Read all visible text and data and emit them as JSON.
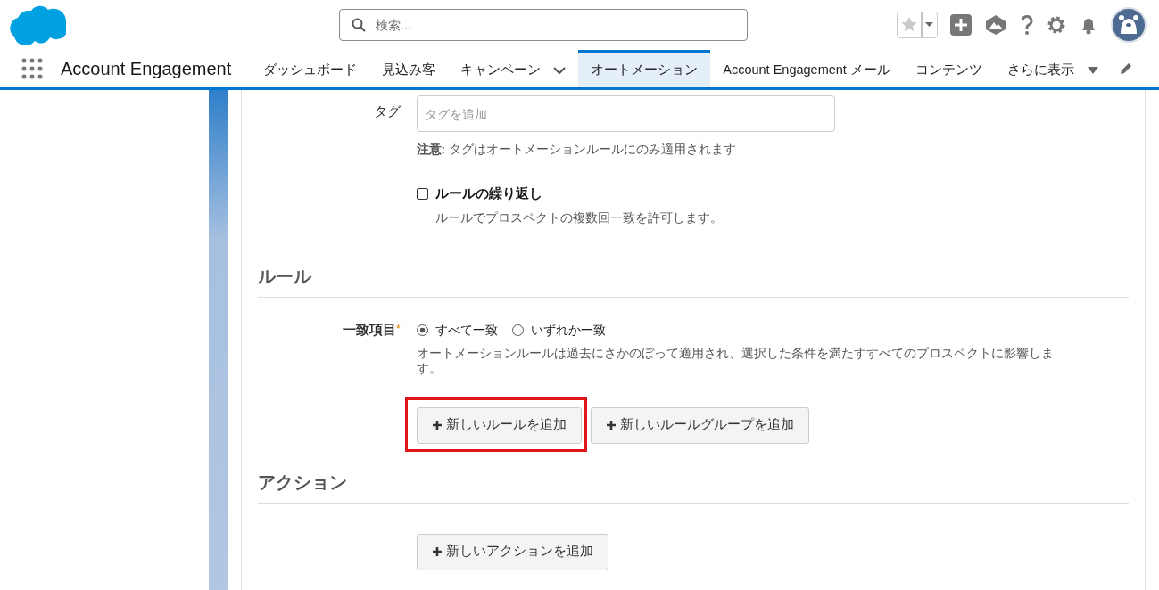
{
  "header": {
    "search": {
      "placeholder": "検索..."
    }
  },
  "nav": {
    "app_name": "Account Engagement",
    "tabs": [
      {
        "label": "ダッシュボード",
        "selected": false,
        "has_menu": false
      },
      {
        "label": "見込み客",
        "selected": false,
        "has_menu": false
      },
      {
        "label": "キャンペーン",
        "selected": false,
        "has_menu": true
      },
      {
        "label": "オートメーション",
        "selected": true,
        "has_menu": false
      },
      {
        "label": "Account Engagement メール",
        "selected": false,
        "has_menu": false
      },
      {
        "label": "コンテンツ",
        "selected": false,
        "has_menu": false
      }
    ],
    "more": "さらに表示"
  },
  "form": {
    "tag": {
      "label": "タグ",
      "placeholder": "タグを追加",
      "note": "**注意:** タグはオートメーションルールにのみ適用されます"
    },
    "repeat": {
      "label": "ルールの繰り返し",
      "checked": false,
      "help": "ルールでプロスペクトの複数回一致を許可します。"
    },
    "rules": {
      "heading": "ルール",
      "match_label": "一致項目",
      "required_mark": "*",
      "options": [
        {
          "label": "すべて一致",
          "selected": true
        },
        {
          "label": "いずれか一致",
          "selected": false
        }
      ],
      "help": "オートメーションルールは過去にさかのぼって適用され、選択した条件を満たすすべてのプロスペクトに影響します。",
      "buttons": [
        {
          "label": "新しいルールを追加",
          "highlighted": true
        },
        {
          "label": "新しいルールグループを追加",
          "highlighted": false
        }
      ]
    },
    "actions": {
      "heading": "アクション",
      "buttons": [
        {
          "label": "新しいアクションを追加",
          "highlighted": false
        }
      ]
    }
  }
}
